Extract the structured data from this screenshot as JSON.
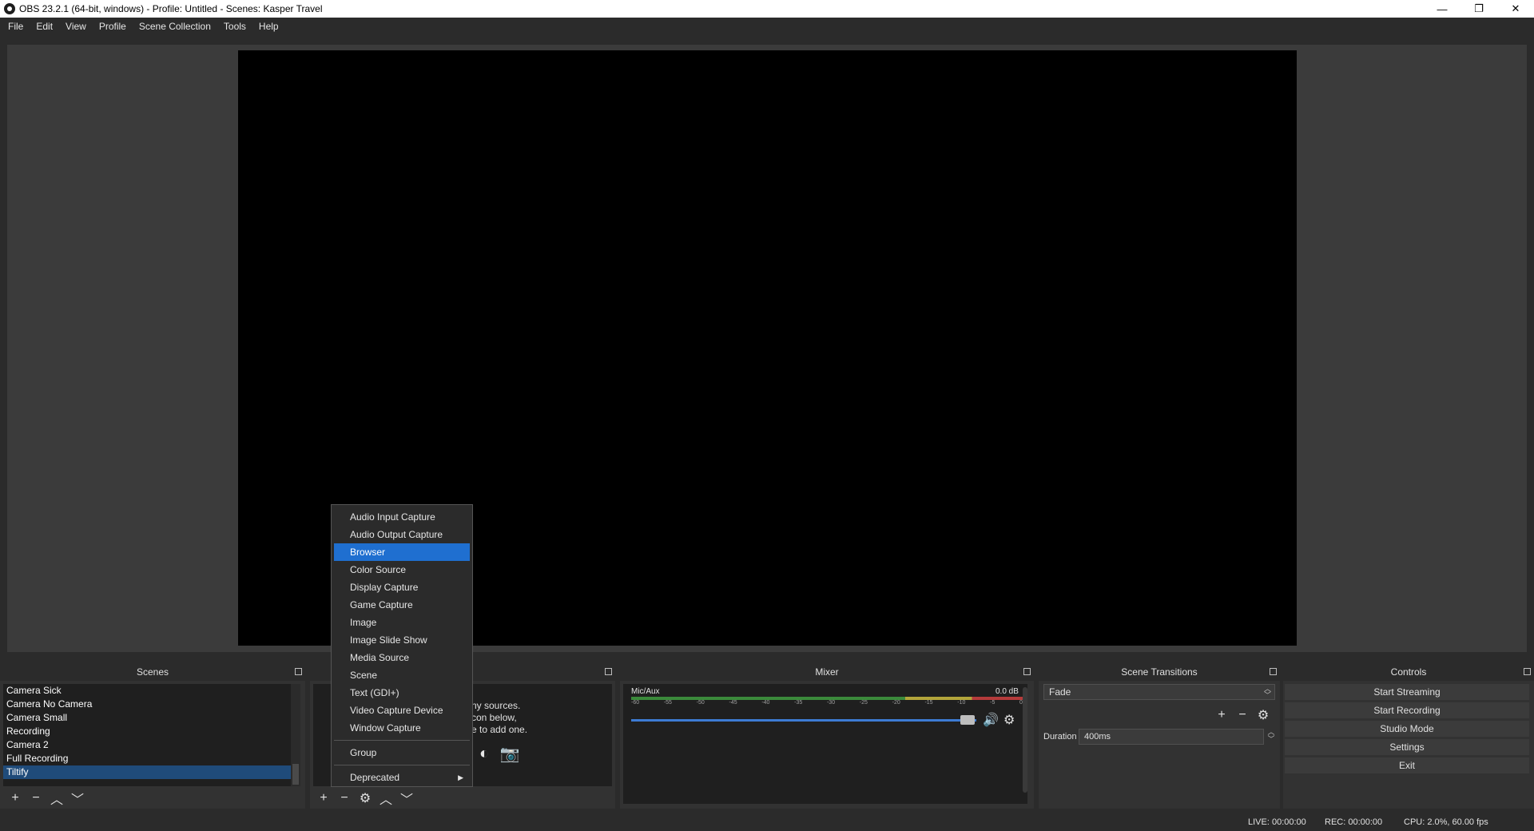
{
  "window": {
    "title": "OBS 23.2.1 (64-bit, windows) - Profile: Untitled - Scenes: Kasper Travel",
    "controls": {
      "minimize": "—",
      "maximize": "❐",
      "close": "✕"
    }
  },
  "menubar": {
    "items": [
      "File",
      "Edit",
      "View",
      "Profile",
      "Scene Collection",
      "Tools",
      "Help"
    ]
  },
  "scenes": {
    "header": "Scenes",
    "items": [
      "Camera Sick",
      "Camera No Camera",
      "Camera Small",
      "Recording",
      "Camera 2",
      "Full Recording",
      "Tiltify"
    ],
    "selected_index": 6
  },
  "sources": {
    "hint_lines": [
      "ny sources.",
      "con below,",
      "e to add one."
    ]
  },
  "mixer": {
    "header": "Mixer",
    "track_name": "Mic/Aux",
    "track_db": "0.0 dB",
    "scale": [
      "-60",
      "-55",
      "-50",
      "-45",
      "-40",
      "-35",
      "-30",
      "-25",
      "-20",
      "-15",
      "-10",
      "-5",
      "0"
    ],
    "volume_fraction": 0.97
  },
  "transitions": {
    "header": "Scene Transitions",
    "selected": "Fade",
    "duration_label": "Duration",
    "duration_value": "400ms"
  },
  "controls": {
    "header": "Controls",
    "buttons": [
      "Start Streaming",
      "Start Recording",
      "Studio Mode",
      "Settings",
      "Exit"
    ]
  },
  "status": {
    "live": "LIVE: 00:00:00",
    "rec": "REC: 00:00:00",
    "cpu": "CPU: 2.0%, 60.00 fps"
  },
  "context_menu": {
    "items": [
      "Audio Input Capture",
      "Audio Output Capture",
      "Browser",
      "Color Source",
      "Display Capture",
      "Game Capture",
      "Image",
      "Image Slide Show",
      "Media Source",
      "Scene",
      "Text (GDI+)",
      "Video Capture Device",
      "Window Capture"
    ],
    "group_label": "Group",
    "deprecated_label": "Deprecated",
    "highlighted": "Browser"
  }
}
